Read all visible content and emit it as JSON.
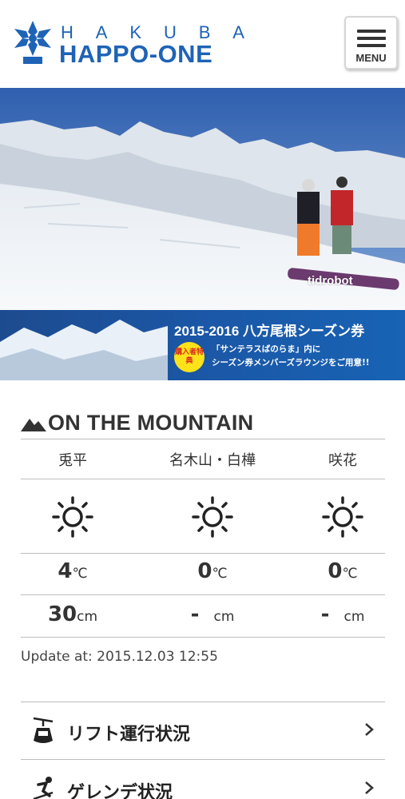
{
  "header": {
    "logo_top": [
      "H",
      "A",
      "K",
      "U",
      "B",
      "A"
    ],
    "logo_main": "HAPPO-ONE",
    "menu_label": "MENU"
  },
  "hero": {
    "watermark": "tidrobot"
  },
  "banner": {
    "title": "2015-2016 八方尾根シーズン券",
    "badge": "購入者特典",
    "line1": "「サンテラスばのらま」内に",
    "line2": "シーズン券メンバーズラウンジをご用意!!"
  },
  "mountain": {
    "title": "ON THE MOUNTAIN",
    "locations": [
      {
        "name": "兎平",
        "weather_icon": "sun-icon",
        "temp": "4",
        "temp_unit": "℃",
        "snow": "30",
        "snow_unit": "cm"
      },
      {
        "name": "名木山・白樺",
        "weather_icon": "sun-icon",
        "temp": "0",
        "temp_unit": "℃",
        "snow": "-",
        "snow_unit": "cm"
      },
      {
        "name": "咲花",
        "weather_icon": "sun-icon",
        "temp": "0",
        "temp_unit": "℃",
        "snow": "-",
        "snow_unit": "cm"
      }
    ],
    "update": "Update at: 2015.12.03 12:55"
  },
  "links": [
    {
      "label": "リフト運行状況",
      "icon": "gondola-icon"
    },
    {
      "label": "ゲレンデ状況",
      "icon": "skier-icon"
    }
  ],
  "colors": {
    "brand_blue": "#1e63b6",
    "banner_blue": "#1b57a6",
    "badge_yellow": "#ffe21a"
  }
}
